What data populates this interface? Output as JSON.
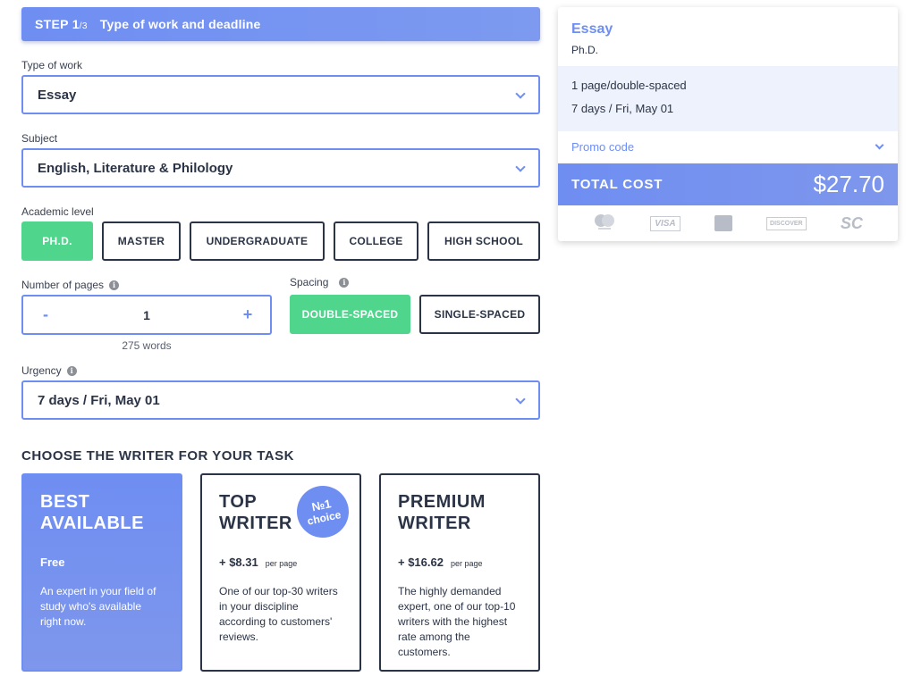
{
  "step": {
    "number": "STEP 1",
    "of": "/3",
    "title": "Type of work and deadline"
  },
  "type_of_work": {
    "label": "Type of work",
    "value": "Essay"
  },
  "subject": {
    "label": "Subject",
    "value": "English, Literature & Philology"
  },
  "academic_level": {
    "label": "Academic level",
    "options": [
      "PH.D.",
      "MASTER",
      "UNDERGRADUATE",
      "COLLEGE",
      "HIGH SCHOOL"
    ],
    "selected": "PH.D."
  },
  "pages": {
    "label": "Number of pages",
    "minus": "-",
    "value": "1",
    "plus": "+",
    "words": "275 words"
  },
  "spacing": {
    "label": "Spacing",
    "options": [
      "DOUBLE-SPACED",
      "SINGLE-SPACED"
    ],
    "selected": "DOUBLE-SPACED"
  },
  "urgency": {
    "label": "Urgency",
    "value": "7 days / Fri, May 01"
  },
  "writer_section": {
    "title": "CHOOSE THE WRITER FOR YOUR TASK",
    "cards": [
      {
        "name_line1": "BEST",
        "name_line2": "AVAILABLE",
        "price": "Free",
        "per": "",
        "desc": "An expert in your field of study who's available right now."
      },
      {
        "name_line1": "TOP",
        "name_line2": "WRITER",
        "price": "+ $8.31",
        "per": "per page",
        "desc": "One of our top-30 writers in your discipline according to customers' reviews.",
        "badge_num": "№1",
        "badge_text": "choice"
      },
      {
        "name_line1": "PREMIUM",
        "name_line2": "WRITER",
        "price": "+ $16.62",
        "per": "per page",
        "desc": "The highly demanded expert, one of our top-10 writers with the highest rate among the customers."
      }
    ]
  },
  "summary": {
    "title": "Essay",
    "level": "Ph.D.",
    "pages": "1 page/double-spaced",
    "deadline": "7 days / Fri, May 01",
    "promo": "Promo code",
    "total_label": "TOTAL COST",
    "total_amount": "$27.70",
    "payment_icons": {
      "visa": "VISA",
      "discover": "DISCOVER",
      "sc": "SC"
    }
  },
  "colors": {
    "accent": "#6f8ef2",
    "selected": "#4fd68c",
    "text": "#2b3446"
  }
}
